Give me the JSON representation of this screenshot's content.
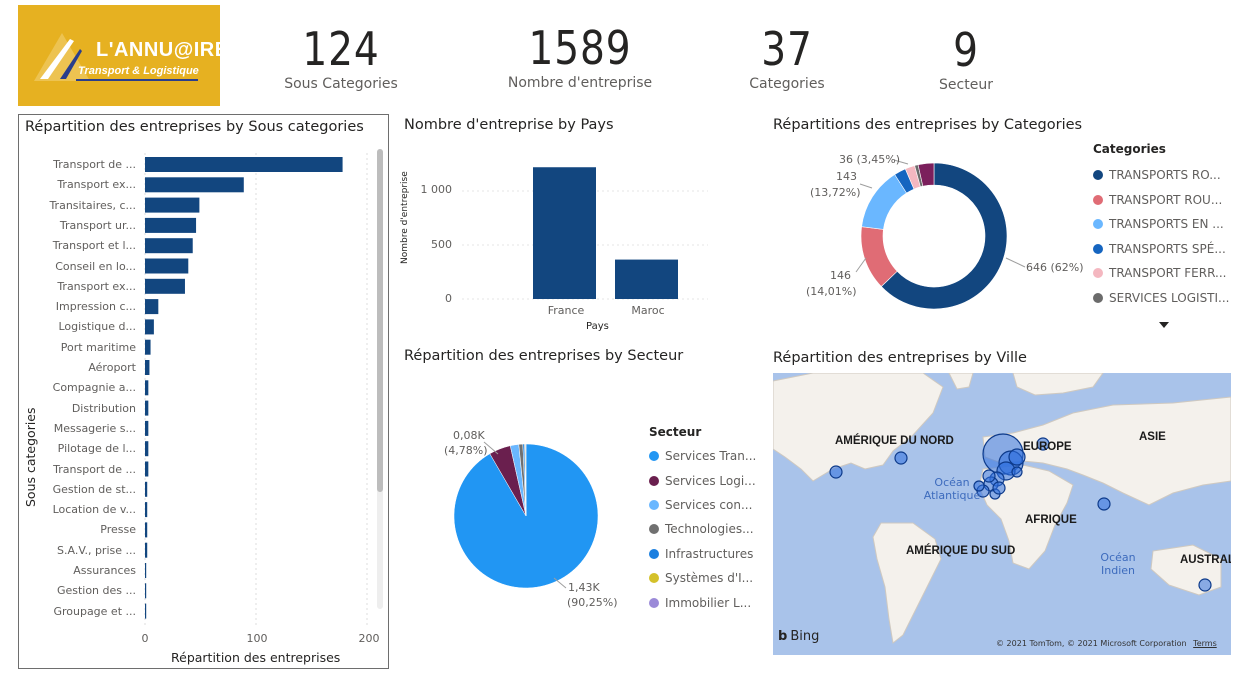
{
  "logo": {
    "main": "L'ANNU@IRE",
    "sub": "Transport & Logistique"
  },
  "kpis": [
    {
      "value": "124",
      "label": "Sous Categories"
    },
    {
      "value": "1589",
      "label": "Nombre d'entreprise"
    },
    {
      "value": "37",
      "label": "Categories"
    },
    {
      "value": "9",
      "label": "Secteur"
    }
  ],
  "bar_chart": {
    "title": "Répartition des entreprises by Sous categories",
    "xlabel": "Répartition des entreprises",
    "ylabel": "Sous categories",
    "x_ticks": [
      "0",
      "100",
      "200"
    ]
  },
  "pays_chart": {
    "title": "Nombre d'entreprise by Pays",
    "xlabel": "Pays",
    "ylabel": "Nombre d'entreprise",
    "y_ticks": [
      "0",
      "500",
      "1 000"
    ]
  },
  "donut_chart": {
    "title": "Répartitions des entreprises by Categories",
    "legend_title": "Categories",
    "labels": {
      "big": "646 (62%)",
      "red_1": "146",
      "red_2": "(14,01%)",
      "lb_1": "143",
      "lb_2": "(13,72%)",
      "top": "36 (3,45%)"
    }
  },
  "pie_chart": {
    "title": "Répartition des entreprises by Secteur",
    "legend_title": "Secteur",
    "labels": {
      "small_1": "0,08K",
      "small_2": "(4,78%)",
      "big_1": "1,43K",
      "big_2": "(90,25%)"
    }
  },
  "map": {
    "title": "Répartition des entreprises by Ville",
    "labels": {
      "na": "AMÉRIQUE DU NORD",
      "eu": "EUROPE",
      "asia": "ASIE",
      "africa": "AFRIQUE",
      "sa": "AMÉRIQUE DU SUD",
      "aus": "AUSTRAL",
      "atl_1": "Océan",
      "atl_2": "Atlantique",
      "ind_1": "Océan",
      "ind_2": "Indien"
    },
    "bing": "Bing",
    "copyright": "© 2021 TomTom, © 2021 Microsoft Corporation",
    "terms": "Terms"
  },
  "chart_data": [
    {
      "type": "bar",
      "orientation": "horizontal",
      "title": "Répartition des entreprises by Sous categories",
      "xlabel": "Répartition des entreprises",
      "ylabel": "Sous categories",
      "categories": [
        "Transport de ...",
        "Transport ex...",
        "Transitaires, c...",
        "Transport ur...",
        "Transport et l...",
        "Conseil en lo...",
        "Transport ex...",
        "Impression c...",
        "Logistique d...",
        "Port maritime",
        "Aéroport",
        "Compagnie a...",
        "Distribution",
        "Messagerie s...",
        "Pilotage de l...",
        "Transport de ...",
        "Gestion de st...",
        "Location de v...",
        "Presse",
        "S.A.V., prise ...",
        "Assurances",
        "Gestion des ...",
        "Groupage et ..."
      ],
      "values": [
        178,
        89,
        49,
        46,
        43,
        39,
        36,
        12,
        8,
        5,
        4,
        3,
        3,
        3,
        3,
        3,
        2,
        2,
        2,
        2,
        1,
        1,
        1
      ],
      "xlim": [
        0,
        210
      ],
      "color": "#12467f"
    },
    {
      "type": "bar",
      "title": "Nombre d'entreprise by Pays",
      "xlabel": "Pays",
      "ylabel": "Nombre d'entreprise",
      "categories": [
        "France",
        "Maroc"
      ],
      "values": [
        1220,
        365
      ],
      "ylim": [
        0,
        1250
      ],
      "color": "#12467f"
    },
    {
      "type": "pie",
      "donut": true,
      "title": "Répartitions des entreprises by Categories",
      "categories": [
        "TRANSPORTS RO...",
        "TRANSPORT ROU...",
        "TRANSPORTS EN ...",
        "TRANSPORTS SPÉ...",
        "TRANSPORT FERR...",
        "SERVICES LOGISTI..."
      ],
      "values": [
        646,
        146,
        143,
        27,
        22,
        8
      ],
      "others": [
        36
      ],
      "colors": [
        "#12467f",
        "#e06c75",
        "#6ab7ff",
        "#1565c0",
        "#f4b7c0",
        "#6b6b6b"
      ],
      "others_colors": [
        "#7b1f5c",
        "#40a0ff",
        "#9b8ad8"
      ]
    },
    {
      "type": "pie",
      "title": "Répartition des entreprises by Secteur",
      "categories": [
        "Services Tran...",
        "Services Logi...",
        "Services con...",
        "Technologies...",
        "Infrastructures",
        "Systèmes d'I...",
        "Immobilier L..."
      ],
      "values": [
        1434,
        76,
        30,
        14,
        6,
        3,
        2
      ],
      "colors": [
        "#2196f3",
        "#6a1f4e",
        "#6ab7ff",
        "#707070",
        "#1a7fe0",
        "#d4c12a",
        "#9b8ad8"
      ]
    }
  ]
}
